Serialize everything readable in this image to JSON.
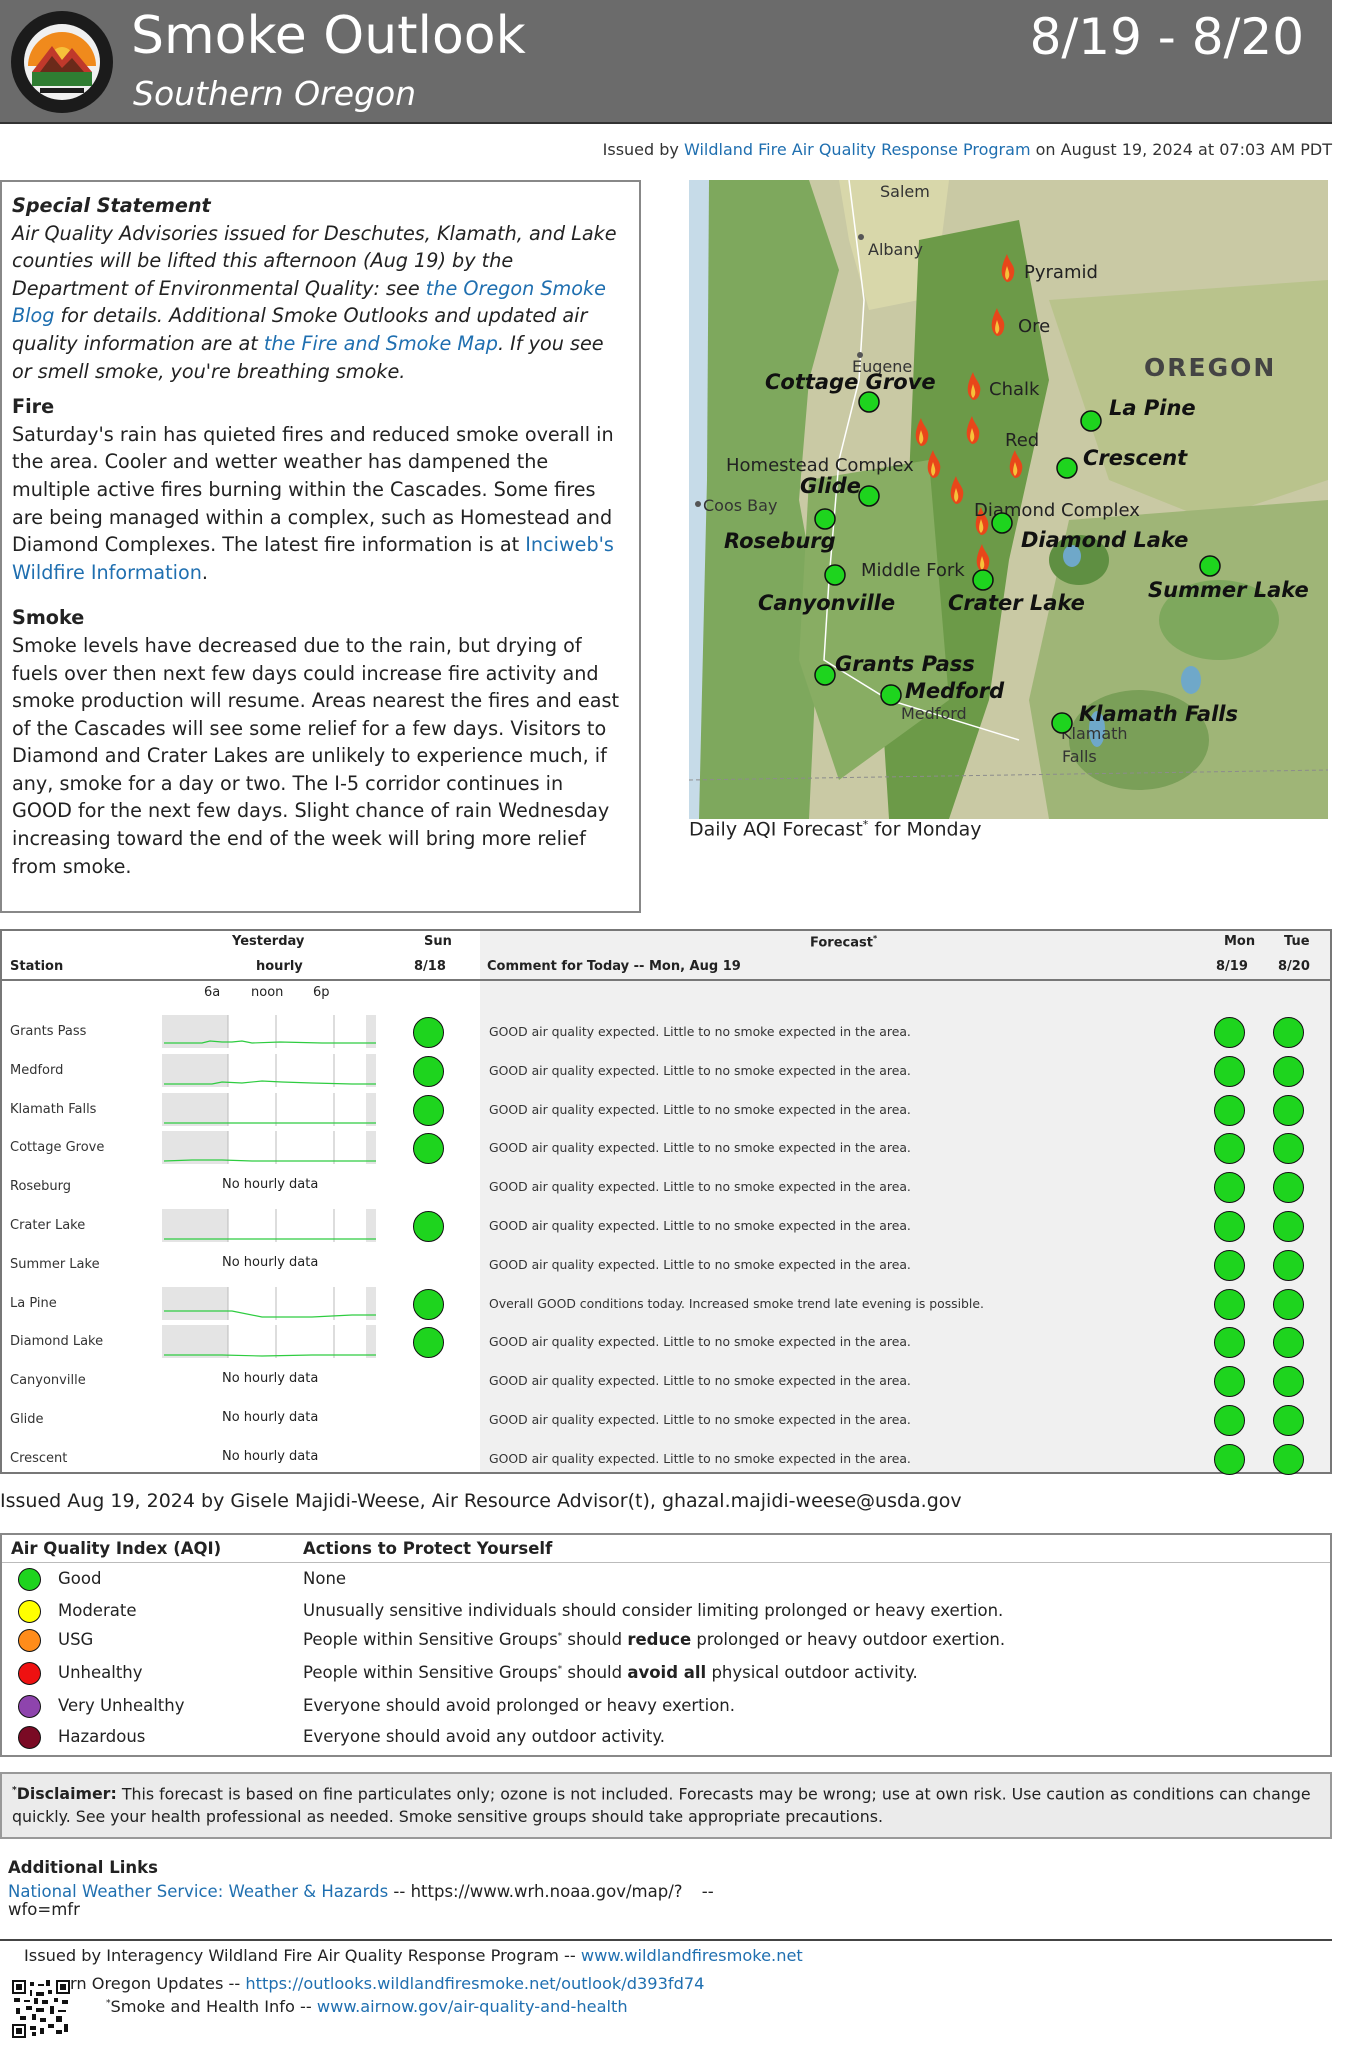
{
  "header": {
    "title": "Smoke Outlook",
    "subtitle": "Southern Oregon",
    "dates": "8/19 - 8/20",
    "logo_text": "INTERAGENCY WILDLAND FIRE AIR QUALITY RESPONSE PROGRAM"
  },
  "issued_line": {
    "prefix": "Issued by",
    "org_link": "Wildland Fire Air Quality Response Program",
    "suffix": "on August 19, 2024 at 07:03 AM PDT"
  },
  "statement": {
    "special_title": "Special Statement",
    "special_1": "Air Quality Advisories issued for Deschutes, Klamath, and Lake counties will be lifted this afternoon (Aug 19) by the Department of Environmental Quality: see",
    "special_link1": "the Oregon Smoke Blog",
    "special_2": "for details. Additional Smoke Outlooks and updated air quality information are at",
    "special_link2": "the Fire and Smoke Map",
    "special_3": ". If you see or smell smoke, you're breathing smoke.",
    "fire_title": "Fire",
    "fire_text": "Saturday's rain has quieted fires and reduced smoke overall in the area. Cooler and wetter weather has dampened the multiple active fires burning within the Cascades. Some fires are being managed within a complex, such as Homestead and Diamond Complexes. The latest fire information is at",
    "fire_link": "Inciweb's Wildfire Information",
    "fire_end": ".",
    "smoke_title": "Smoke",
    "smoke_text": "Smoke levels have decreased due to the rain, but drying of fuels over then next few days could increase fire activity and smoke production will resume. Areas nearest the fires and east of the Cascades will see some relief for a few days. Visitors to Diamond and Crater Lakes are unlikely to experience much, if any, smoke for a day or two. The I-5 corridor continues in GOOD for the next few days. Slight chance of rain Wednesday increasing toward the end of the week will bring more relief from smoke."
  },
  "map": {
    "caption": "Daily AQI Forecast",
    "caption_sup": "*",
    "caption_suffix": " for Monday",
    "state_label": "OREGON",
    "base_labels": [
      "Salem",
      "Albany",
      "Eugene",
      "Coos Bay",
      "Medford",
      "Klamath",
      "Falls"
    ],
    "fire_labels": [
      "Pyramid",
      "Ore",
      "Chalk",
      "Red",
      "Homestead Complex",
      "Diamond Complex",
      "Middle Fork"
    ],
    "station_labels": [
      "Cottage Grove",
      "La Pine",
      "Crescent",
      "Glide",
      "Roseburg",
      "Diamond Lake",
      "Summer Lake",
      "Canyonville",
      "Crater Lake",
      "Grants Pass",
      "Medford",
      "Klamath Falls"
    ]
  },
  "forecast_table": {
    "headers": {
      "station": "Station",
      "yesterday_1": "Yesterday",
      "yesterday_2": "hourly",
      "sun_1": "Sun",
      "sun_2": "8/18",
      "forecast": "Forecast",
      "forecast_sup": "*",
      "comment": "Comment for Today -- Mon, Aug 19",
      "mon_1": "Mon",
      "mon_2": "8/19",
      "tue_1": "Tue",
      "tue_2": "8/20"
    },
    "hourly_ticks": [
      "6a",
      "noon",
      "6p"
    ],
    "no_hourly": "No hourly data",
    "rows": [
      {
        "station": "Grants Pass",
        "hourly": true,
        "comment": "GOOD air quality expected. Little to no smoke expected in the area.",
        "sun": "good",
        "mon": "good",
        "tue": "good"
      },
      {
        "station": "Medford",
        "hourly": true,
        "comment": "GOOD air quality expected. Little to no smoke expected in the area.",
        "sun": "good",
        "mon": "good",
        "tue": "good"
      },
      {
        "station": "Klamath Falls",
        "hourly": true,
        "comment": "GOOD air quality expected. Little to no smoke expected in the area.",
        "sun": "good",
        "mon": "good",
        "tue": "good"
      },
      {
        "station": "Cottage Grove",
        "hourly": true,
        "comment": "GOOD air quality expected. Little to no smoke expected in the area.",
        "sun": "good",
        "mon": "good",
        "tue": "good"
      },
      {
        "station": "Roseburg",
        "hourly": false,
        "comment": "GOOD air quality expected. Little to no smoke expected in the area.",
        "sun": null,
        "mon": "good",
        "tue": "good"
      },
      {
        "station": "Crater Lake",
        "hourly": true,
        "comment": "GOOD air quality expected. Little to no smoke expected in the area.",
        "sun": "good",
        "mon": "good",
        "tue": "good"
      },
      {
        "station": "Summer Lake",
        "hourly": false,
        "comment": "GOOD air quality expected. Little to no smoke expected in the area.",
        "sun": null,
        "mon": "good",
        "tue": "good"
      },
      {
        "station": "La Pine",
        "hourly": true,
        "comment": "Overall GOOD conditions today. Increased smoke trend late evening is possible.",
        "sun": "good",
        "mon": "good",
        "tue": "good"
      },
      {
        "station": "Diamond Lake",
        "hourly": true,
        "comment": "GOOD air quality expected. Little to no smoke expected in the area.",
        "sun": "good",
        "mon": "good",
        "tue": "good"
      },
      {
        "station": "Canyonville",
        "hourly": false,
        "comment": "GOOD air quality expected. Little to no smoke expected in the area.",
        "sun": null,
        "mon": "good",
        "tue": "good"
      },
      {
        "station": "Glide",
        "hourly": false,
        "comment": "GOOD air quality expected. Little to no smoke expected in the area.",
        "sun": null,
        "mon": "good",
        "tue": "good"
      },
      {
        "station": "Crescent",
        "hourly": false,
        "comment": "GOOD air quality expected. Little to no smoke expected in the area.",
        "sun": null,
        "mon": "good",
        "tue": "good"
      }
    ]
  },
  "issued_by": "Issued Aug 19, 2024 by Gisele Majidi-Weese, Air Resource Advisor(t), ghazal.majidi-weese@usda.gov",
  "aqi_legend": {
    "header_index": "Air Quality Index (AQI)",
    "header_actions": "Actions to Protect Yourself",
    "rows": [
      {
        "category": "Good",
        "color": "#1ed41e",
        "action": "None"
      },
      {
        "category": "Moderate",
        "color": "#ffff00",
        "action": "Unusually sensitive individuals should consider limiting prolonged or heavy exertion."
      },
      {
        "category": "USG",
        "color": "#ff8c1a",
        "action_pre": "People within Sensitive Groups",
        "action_sup": "*",
        "action_mid": " should ",
        "action_bold": "reduce",
        "action_post": " prolonged or heavy outdoor exertion."
      },
      {
        "category": "Unhealthy",
        "color": "#ee1111",
        "action_pre": "People within Sensitive Groups",
        "action_sup": "*",
        "action_mid": " should ",
        "action_bold": "avoid all",
        "action_post": " physical outdoor activity."
      },
      {
        "category": "Very Unhealthy",
        "color": "#8e44ad",
        "action": "Everyone should avoid prolonged or heavy exertion."
      },
      {
        "category": "Hazardous",
        "color": "#7a0a24",
        "action": "Everyone should avoid any outdoor activity."
      }
    ]
  },
  "disclaimer": {
    "sup": "*",
    "label": "Disclaimer:",
    "text": " This forecast is based on fine particulates only; ozone is not included. Forecasts may be wrong; use at own risk. Use caution as conditions can change quickly. See your health professional as needed. Smoke sensitive groups should take appropriate precautions."
  },
  "additional_links": {
    "title": "Additional Links",
    "nws_link": "National Weather Service: Weather & Hazards",
    "nws_sep": " -- ",
    "nws_url_1": "https://www.wrh.noaa.gov/map/?",
    "nws_url_2": "wfo=mfr",
    "trailing": "--"
  },
  "footer": {
    "line1_prefix": "Issued by Interagency Wildland Fire Air Quality Response Program -- ",
    "line1_link": "www.wildlandfiresmoke.net",
    "line2_prefix": "ern Oregon Updates -- ",
    "line2_link": "https://outlooks.wildlandfiresmoke.net/outlook/d393fd74",
    "line3_sup": "*",
    "line3_prefix": "Smoke and Health Info -- ",
    "line3_link": "www.airnow.gov/air-quality-and-health"
  },
  "colors": {
    "header_bg": "#6b6b6b",
    "good": "#1ed41e",
    "link": "#1f6fb0",
    "fire": "#e8461a"
  }
}
